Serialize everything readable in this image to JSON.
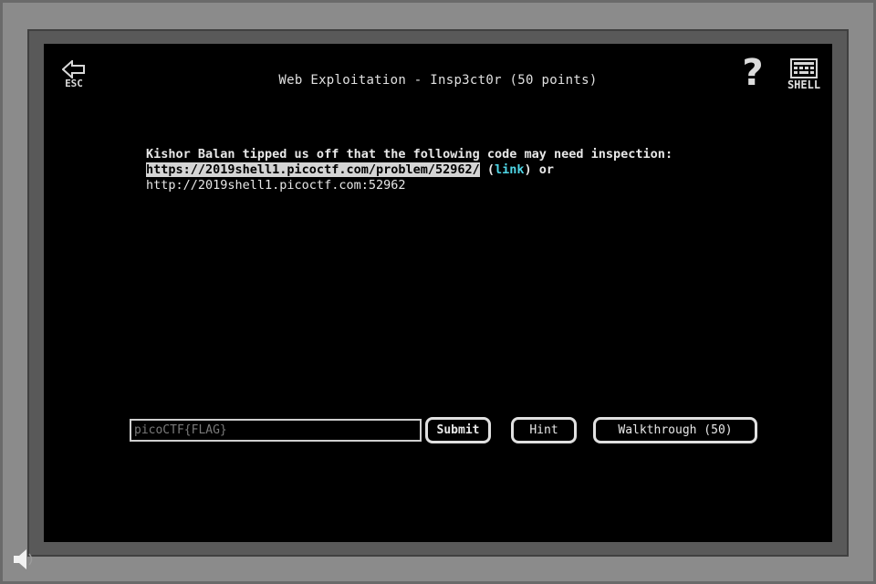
{
  "header": {
    "esc_label": "ESC",
    "title": "Web Exploitation - Insp3ct0r (50 points)",
    "help_label": "?",
    "shell_label": "SHELL"
  },
  "problem": {
    "line1": "Kishor Balan tipped us off that the following code may need inspection:",
    "url": "https://2019shell1.picoctf.com/problem/52962/",
    "link_open": "(",
    "link_label": "link",
    "link_close": ") or",
    "alt_url": "http://2019shell1.picoctf.com:52962"
  },
  "answer": {
    "placeholder": "picoCTF{FLAG}",
    "submit_label": "Submit",
    "hint_label": "Hint",
    "walkthrough_label": "Walkthrough (50)"
  },
  "icons": {
    "esc": "back-arrow-icon",
    "help": "question-mark-icon",
    "shell": "terminal-icon",
    "sound": "speaker-icon"
  }
}
